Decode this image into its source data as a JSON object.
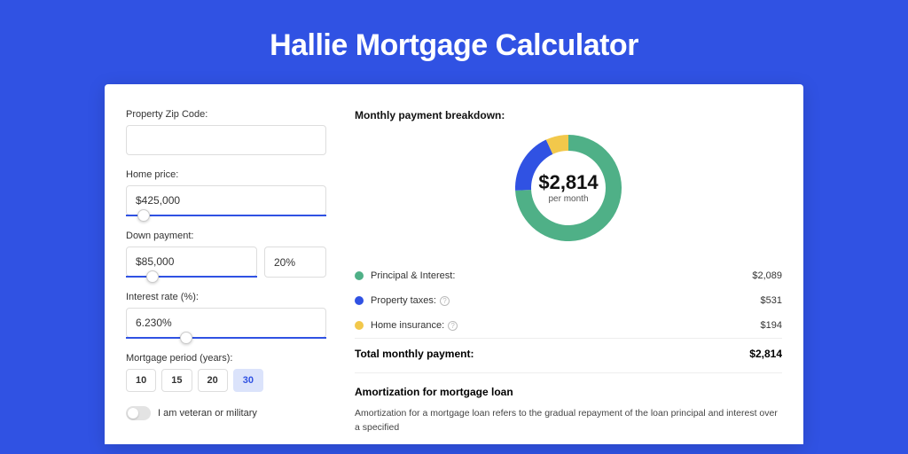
{
  "title": "Hallie Mortgage Calculator",
  "form": {
    "zip_label": "Property Zip Code:",
    "zip_value": "",
    "home_price_label": "Home price:",
    "home_price_value": "$425,000",
    "home_price_slider_pct": 9,
    "down_payment_label": "Down payment:",
    "down_payment_value": "$85,000",
    "down_payment_pct_value": "20%",
    "down_payment_slider_pct": 20,
    "interest_label": "Interest rate (%):",
    "interest_value": "6.230%",
    "interest_slider_pct": 30,
    "period_label": "Mortgage period (years):",
    "period_options": [
      "10",
      "15",
      "20",
      "30"
    ],
    "period_selected": "30",
    "veteran_label": "I am veteran or military",
    "veteran_on": false
  },
  "breakdown": {
    "title": "Monthly payment breakdown:",
    "center_value": "$2,814",
    "center_sub": "per month",
    "items": [
      {
        "label": "Principal & Interest:",
        "value": "$2,089",
        "color": "#4fb087",
        "info": false
      },
      {
        "label": "Property taxes:",
        "value": "$531",
        "color": "#3052e3",
        "info": true
      },
      {
        "label": "Home insurance:",
        "value": "$194",
        "color": "#f2c84b",
        "info": true
      }
    ],
    "total_label": "Total monthly payment:",
    "total_value": "$2,814"
  },
  "amort": {
    "title": "Amortization for mortgage loan",
    "text": "Amortization for a mortgage loan refers to the gradual repayment of the loan principal and interest over a specified"
  },
  "chart_data": {
    "type": "pie",
    "title": "Monthly payment breakdown",
    "categories": [
      "Principal & Interest",
      "Property taxes",
      "Home insurance"
    ],
    "values": [
      2089,
      531,
      194
    ],
    "colors": [
      "#4fb087",
      "#3052e3",
      "#f2c84b"
    ],
    "total": 2814,
    "unit": "USD"
  }
}
